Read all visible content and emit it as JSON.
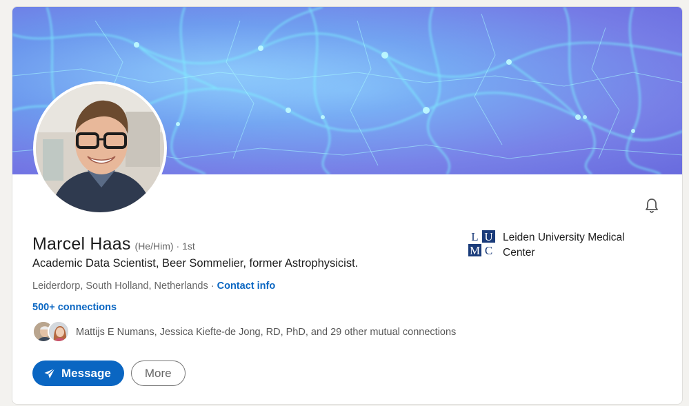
{
  "profile": {
    "name": "Marcel Haas",
    "pronouns": "(He/Him)",
    "degree": "· 1st",
    "headline": "Academic Data Scientist, Beer Sommelier, former Astrophysicist.",
    "location": "Leiderdorp, South Holland, Netherlands",
    "location_sep": " · ",
    "contact_label": "Contact info",
    "connections": "500+ connections"
  },
  "organization": {
    "name": "Leiden University Medical Center",
    "logo_letters": [
      "L",
      "U",
      "M",
      "C"
    ],
    "logo_color": "#1a3b7a"
  },
  "mutual": {
    "name1": "Mattijs E Numans",
    "sep": ", ",
    "name2": "Jessica Kiefte-de Jong, RD, PhD",
    "rest": ", and 29 other mutual connections"
  },
  "actions": {
    "message_label": "Message",
    "more_label": "More"
  },
  "icons": {
    "bell": "bell-icon",
    "send": "paper-plane-icon"
  },
  "colors": {
    "accent": "#0a66c2",
    "banner_base": "#7b7ee8",
    "banner_filament": "#7ff3ff"
  }
}
